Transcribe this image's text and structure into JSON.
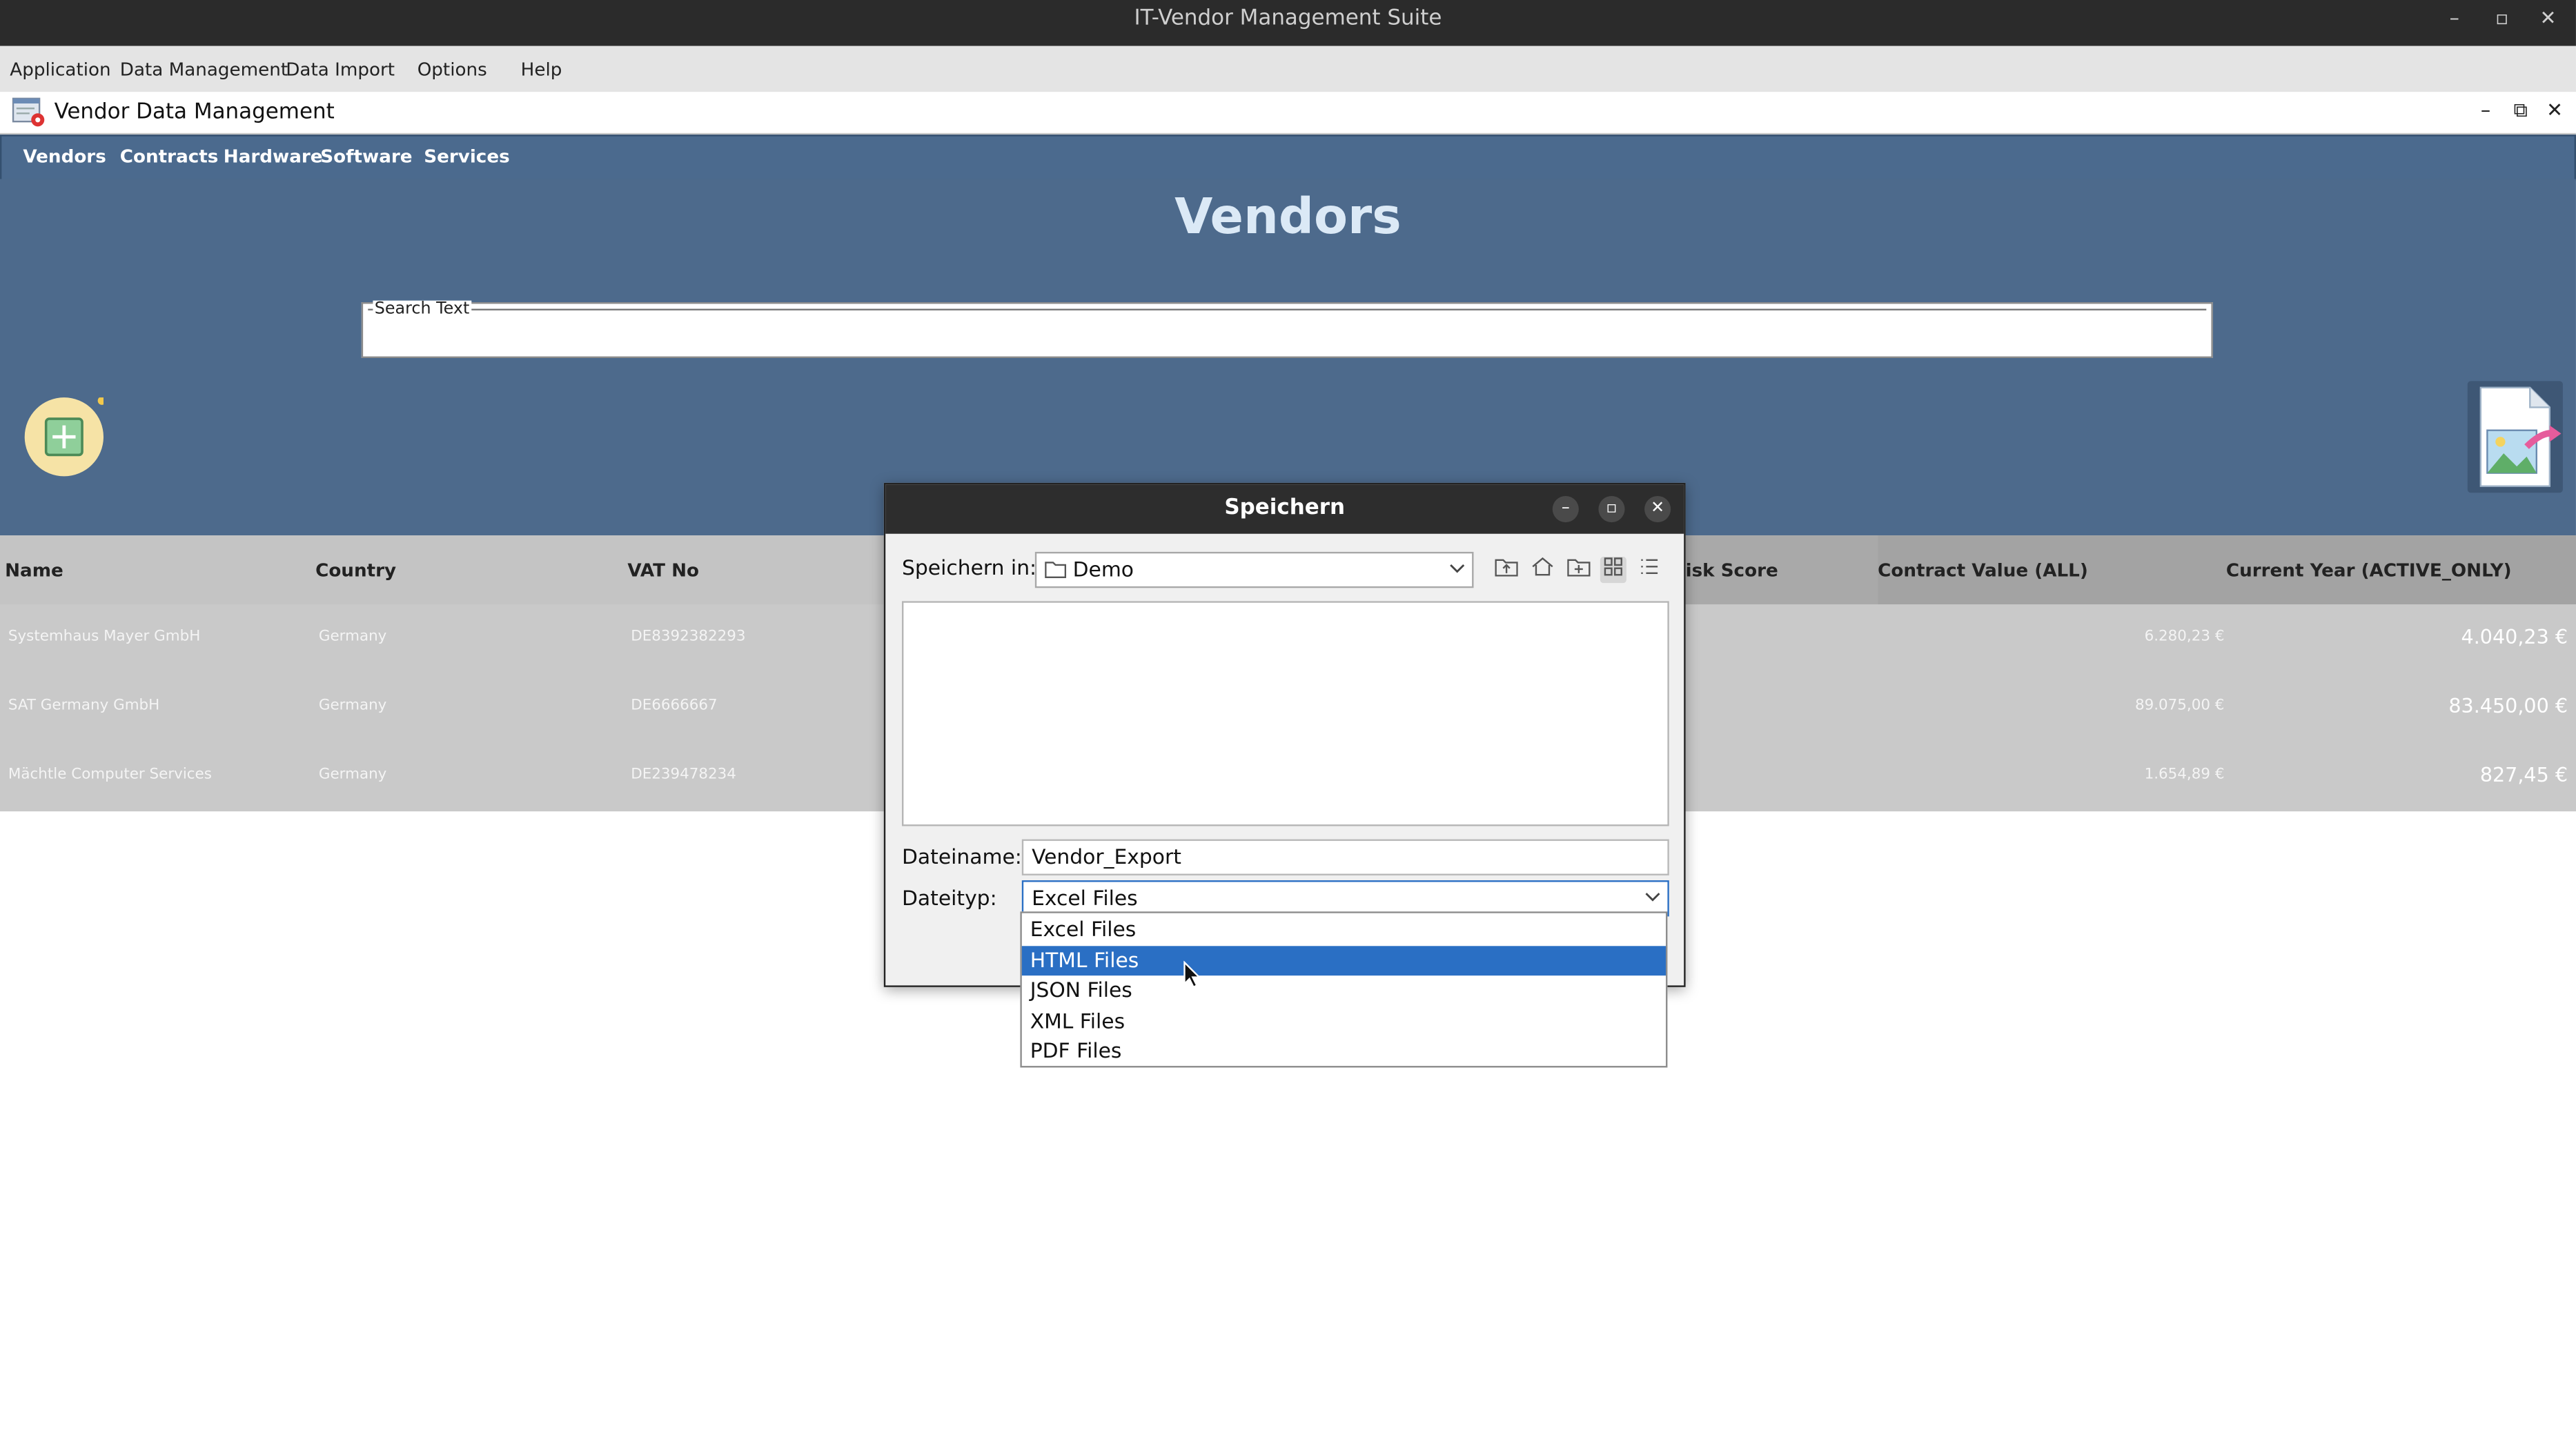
{
  "os": {
    "title": "IT-Vendor Management Suite",
    "minimize": "–",
    "maximize": "▫",
    "close": "✕"
  },
  "menubar": {
    "items": [
      "Application",
      "Data Management",
      "Data Import",
      "Options",
      "Help"
    ]
  },
  "frame": {
    "title": "Vendor Data Management",
    "minimize": "–",
    "restore": "⧉",
    "close": "✕"
  },
  "tabs": [
    "Vendors",
    "Contracts",
    "Hardware",
    "Software",
    "Services"
  ],
  "page": {
    "heading": "Vendors",
    "search_legend": "Search Text",
    "search_value": ""
  },
  "table": {
    "headers": {
      "name": "Name",
      "country": "Country",
      "vat": "VAT No",
      "risk": "isk Score",
      "contract_value": "Contract Value (ALL)",
      "current_year": "Current Year (ACTIVE_ONLY)"
    },
    "rows": [
      {
        "name": "Systemhaus Mayer GmbH",
        "country": "Germany",
        "vat": "DE8392382293",
        "contract_value": "6.280,23 €",
        "current_year": "4.040,23 €"
      },
      {
        "name": "SAT Germany GmbH",
        "country": "Germany",
        "vat": "DE6666667",
        "contract_value": "89.075,00 €",
        "current_year": "83.450,00 €"
      },
      {
        "name": "Mächtle Computer Services",
        "country": "Germany",
        "vat": "DE239478234",
        "contract_value": "1.654,89 €",
        "current_year": "827,45 €"
      }
    ]
  },
  "dialog": {
    "title": "Speichern",
    "minimize": "–",
    "maximize": "▫",
    "close": "✕",
    "save_in_label": "Speichern in:",
    "save_in_value": "Demo",
    "filename_label": "Dateiname:",
    "filename_value": "Vendor_Export",
    "filetype_label": "Dateityp:",
    "filetype_value": "Excel Files",
    "filetype_options": [
      "Excel Files",
      "HTML Files",
      "JSON Files",
      "XML Files",
      "PDF Files"
    ],
    "selected_option": "HTML Files"
  },
  "colors": {
    "tab_band": "#4b6a8e",
    "heading": "#dbe9f6",
    "selection": "#2a6fc4",
    "table_bg": "#c9c9c9"
  }
}
